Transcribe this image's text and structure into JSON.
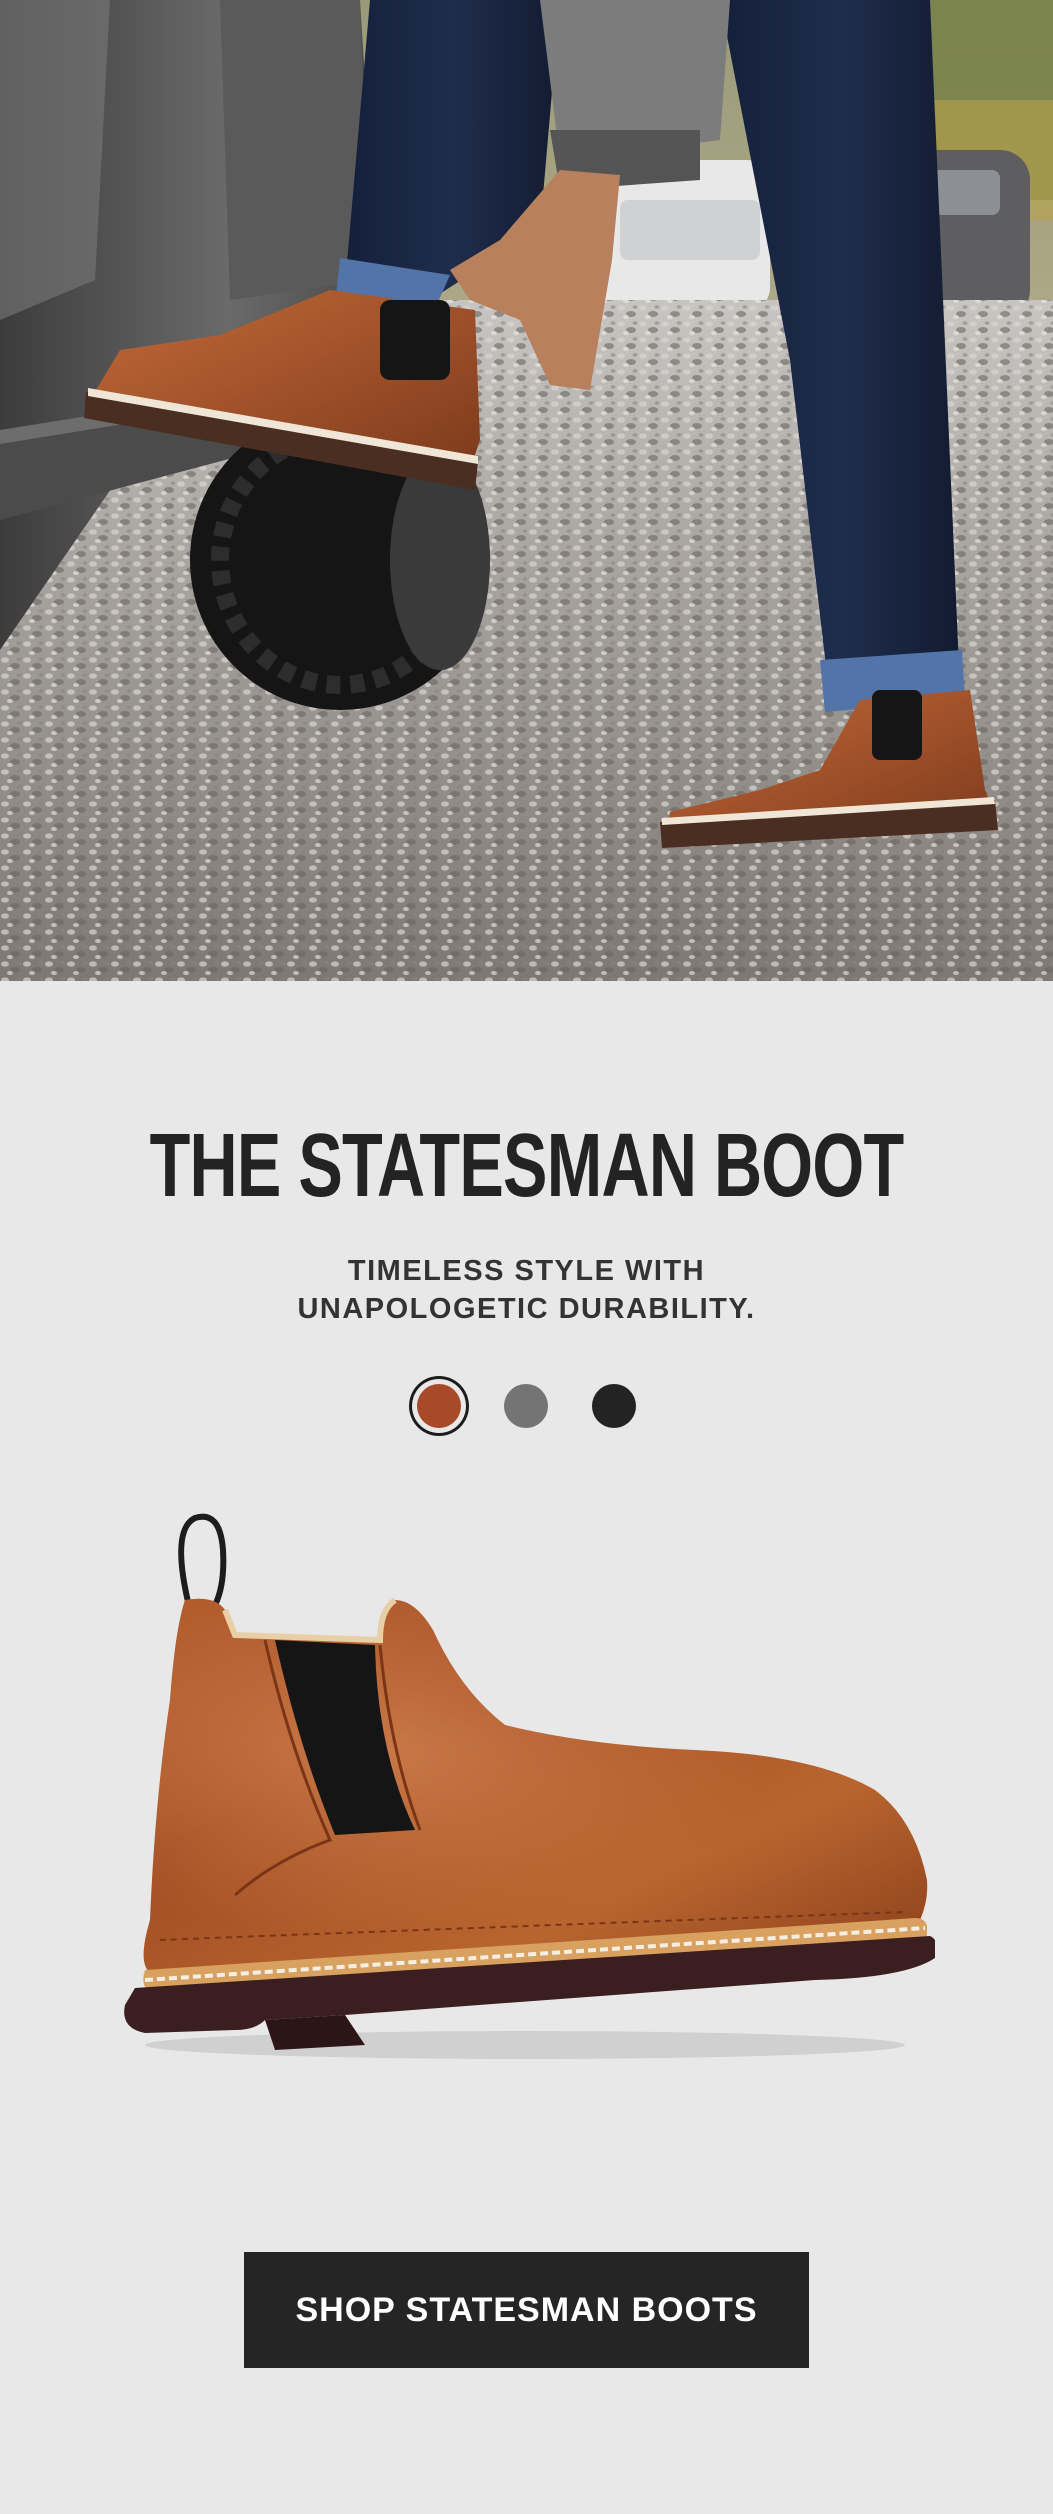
{
  "hero": {
    "image_icon": "boot-lifestyle-photo"
  },
  "product": {
    "title": "THE STATESMAN BOOT",
    "tagline": [
      "TIMELESS STYLE WITH",
      "UNAPOLOGETIC DURABILITY."
    ],
    "swatches": [
      {
        "name": "brown",
        "color": "#a84a27",
        "selected": true
      },
      {
        "name": "grey",
        "color": "#747474",
        "selected": false
      },
      {
        "name": "black",
        "color": "#232323",
        "selected": false
      }
    ],
    "image_icon": "chelsea-boot-product-image"
  },
  "cta": {
    "label": "SHOP STATESMAN BOOTS"
  },
  "colors": {
    "background": "#e9e8e9",
    "text": "#232323",
    "button": "#252525",
    "button_text": "#ffffff",
    "leather": "#a0522d"
  }
}
